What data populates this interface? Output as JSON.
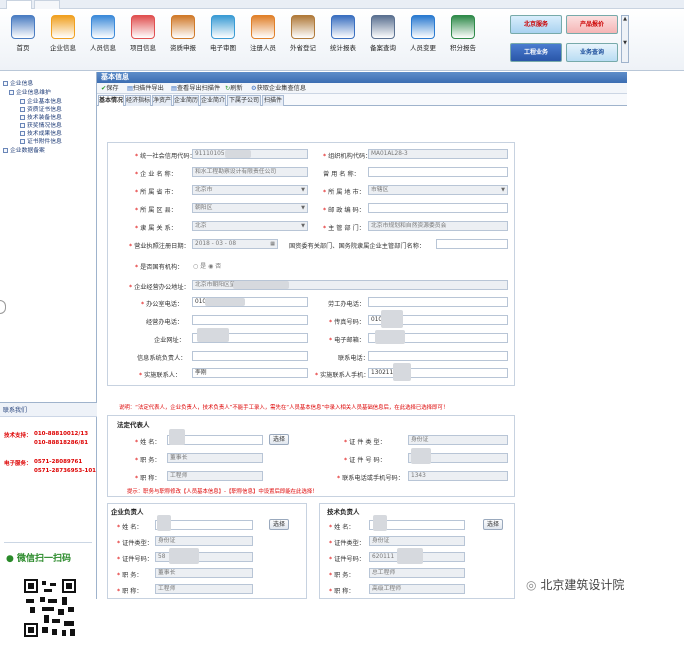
{
  "toolbar": {
    "items": [
      {
        "label": "首页",
        "icon": "home-icon",
        "color": "#4a7cc2"
      },
      {
        "label": "企业信息",
        "icon": "folder-icon",
        "color": "#f0a020"
      },
      {
        "label": "人员信息",
        "icon": "person-add-icon",
        "color": "#3c8ad9"
      },
      {
        "label": "项目信息",
        "icon": "stack-icon",
        "color": "#e05050"
      },
      {
        "label": "资质申报",
        "icon": "book-icon",
        "color": "#d07a2a"
      },
      {
        "label": "电子审图",
        "icon": "document-pen-icon",
        "color": "#3a9bd4"
      },
      {
        "label": "注册人员",
        "icon": "people-icon",
        "color": "#e0802a"
      },
      {
        "label": "外省登记",
        "icon": "clipboard-icon",
        "color": "#b07a3a"
      },
      {
        "label": "统计报表",
        "icon": "chart-icon",
        "color": "#3a6fc0"
      },
      {
        "label": "备案查询",
        "icon": "database-search-icon",
        "color": "#5a7090"
      },
      {
        "label": "人员变更",
        "icon": "user-change-icon",
        "color": "#2a7ad0"
      },
      {
        "label": "积分报告",
        "icon": "globe-icon",
        "color": "#2f8a4a"
      }
    ],
    "banners": [
      "北京服务",
      "产品报价",
      "工程业务",
      "业务查询"
    ]
  },
  "tree": {
    "root": "企业信息",
    "group": "企业信息维护",
    "items": [
      "企业基本信息",
      "资质证书信息",
      "技术装备信息",
      "获奖情况信息",
      "技术成果信息",
      "证书附件信息"
    ],
    "other": "企业数据备案"
  },
  "contact": {
    "header": "联系我们",
    "tech_label": "技术支持：",
    "tech_phones": [
      "010-88810012/13",
      "010-88818286/81"
    ],
    "ecard_label": "电子服务：",
    "ecard_phones": [
      "0571-28089761",
      "0571-28736953-101"
    ],
    "qr_text": "微信扫一扫码"
  },
  "main": {
    "title": "基本信息",
    "actions": [
      "保存",
      "扫描件导出",
      "查看导出扫描件",
      "刷新",
      "获取企业集查信息"
    ],
    "tabs": [
      "基本情况",
      "经济指标",
      "净资产",
      "企业简历",
      "企业简介",
      "下属子公司",
      "扫描件"
    ],
    "form": {
      "credit_code_label": "统一社会信用代码：",
      "credit_code": "91110105",
      "org_code_label": "组织机构代码：",
      "org_code": "MA01AL28-3",
      "name_label": "企 业 名 称：",
      "name": "和水工程勘察设计有限责任公司",
      "former_name_label": "曾 用 名 称：",
      "former_name": "",
      "province_label": "所 属 省 市：",
      "province": "北京市",
      "city_label": "所 属 地 市：",
      "city": "市辖区",
      "district_label": "所 属 区 县：",
      "district": "朝阳区",
      "zip_label": "邮 政 编 码：",
      "zip": "",
      "relation_label": "隶 属 关 系：",
      "relation": "北京",
      "dept_label": "主 管 部 门：",
      "dept": "北京市规划和自然资源委员会",
      "date_label": "营业执照注册日期：",
      "date": "2018 - 03 - 08",
      "sasac_label": "国资委有关部门、国务院隶属企业主管部门名称：",
      "gov_label": "是否国有机构：",
      "gov_opt1": "是",
      "gov_opt2": "否",
      "address_label": "企业经营办公地址：",
      "address": "北京市朝阳区望京",
      "office_label": "办公室电话：",
      "office": "010-",
      "hr_label": "劳工办电话：",
      "pr_label": "经营办电话：",
      "fax_label": "传真号码：",
      "fax": "010-",
      "site_label": "企业网址：",
      "mail_label": "电子邮箱：",
      "sys_label": "信息系统负责人：",
      "contact_phone_label": "联系电话：",
      "liaison_label": "实施联系人：",
      "liaison": "李刚",
      "liaison_mobile_label": "实施联系人手机：",
      "liaison_mobile": "1302112"
    },
    "warning": "说明：“法定代表人，企业负责人，技术负责人”不能手工录入，需先在“人员基本信息”中录入相关人员基础信息后，在此选择已选择即可！",
    "legal": {
      "header": "法定代表人",
      "name_label": "姓 名：",
      "select": "选择",
      "idtype_label": "证 件 类 型：",
      "idtype": "身份证",
      "duty_label": "职 务：",
      "duty": "董事长",
      "idno_label": "证 件 号 码：",
      "title_label": "职 称：",
      "title": "工程师",
      "phone_label": "联系电话或手机号码：",
      "phone": "1343",
      "tip": "提示：职务与职称修改【人员基本信息】-【职称信息】中设置后即能在此选择！"
    },
    "boss": {
      "header": "企业负责人",
      "name_label": "姓 名：",
      "select": "选择",
      "idtype_label": "证件类型：",
      "idtype": "身份证",
      "idno_label": "证件号码：",
      "idno": "58",
      "duty_label": "职 务：",
      "duty": "董事长",
      "title_label": "职 称：",
      "title": "工程师"
    },
    "tech": {
      "header": "技术负责人",
      "name_label": "姓 名：",
      "select": "选择",
      "idtype_label": "证件类型：",
      "idtype": "身份证",
      "idno_label": "证件号码：",
      "idno": "620111",
      "duty_label": "职 务：",
      "duty": "总工程师",
      "title_label": "职 称：",
      "title": "高级工程师"
    }
  },
  "watermark": "北京建筑设计院"
}
